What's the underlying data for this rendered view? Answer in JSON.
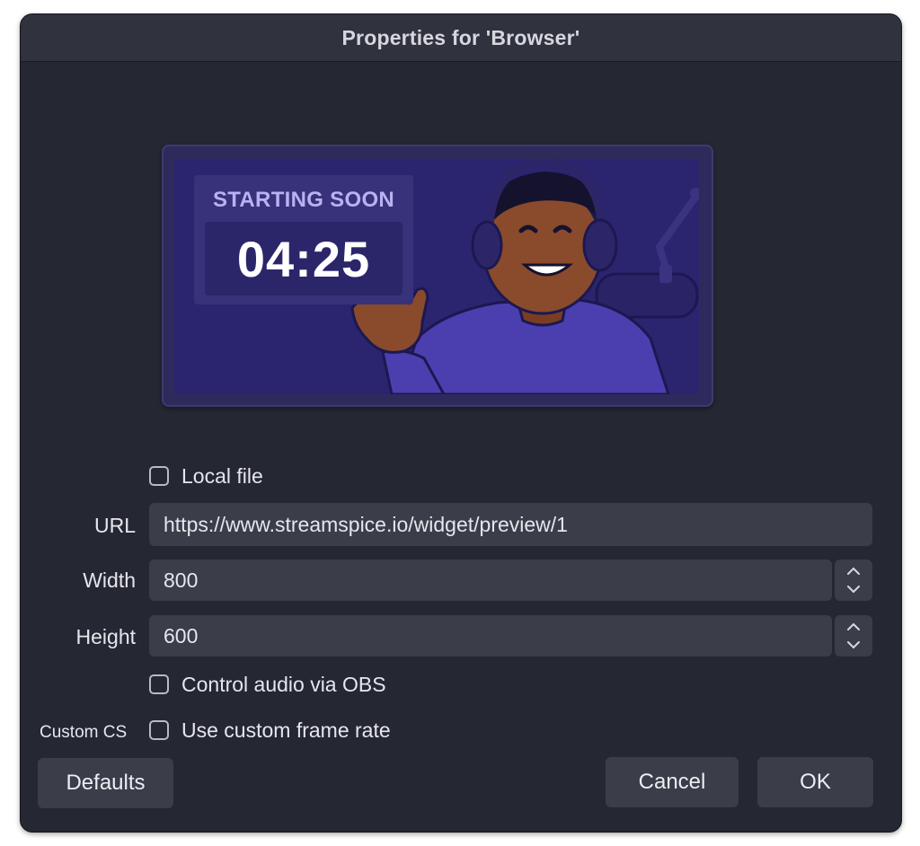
{
  "window": {
    "title": "Properties for 'Browser'"
  },
  "preview": {
    "countdown_label": "STARTING SOON",
    "countdown_time": "04:25"
  },
  "form": {
    "local_file": {
      "label": "Local file",
      "checked": false
    },
    "url": {
      "label": "URL",
      "value": "https://www.streamspice.io/widget/preview/1"
    },
    "width": {
      "label": "Width",
      "value": "800"
    },
    "height": {
      "label": "Height",
      "value": "600"
    },
    "control_audio": {
      "label": "Control audio via OBS",
      "checked": false
    },
    "custom_css_label": "Custom CS",
    "custom_frame_rate": {
      "label": "Use custom frame rate",
      "checked": false
    }
  },
  "buttons": {
    "defaults": "Defaults",
    "cancel": "Cancel",
    "ok": "OK"
  },
  "colors": {
    "window_bg": "#252733",
    "titlebar_bg": "#30323d",
    "field_bg": "#3b3d49",
    "preview_bg": "#2b2570",
    "accent_text": "#b9b2f2"
  }
}
